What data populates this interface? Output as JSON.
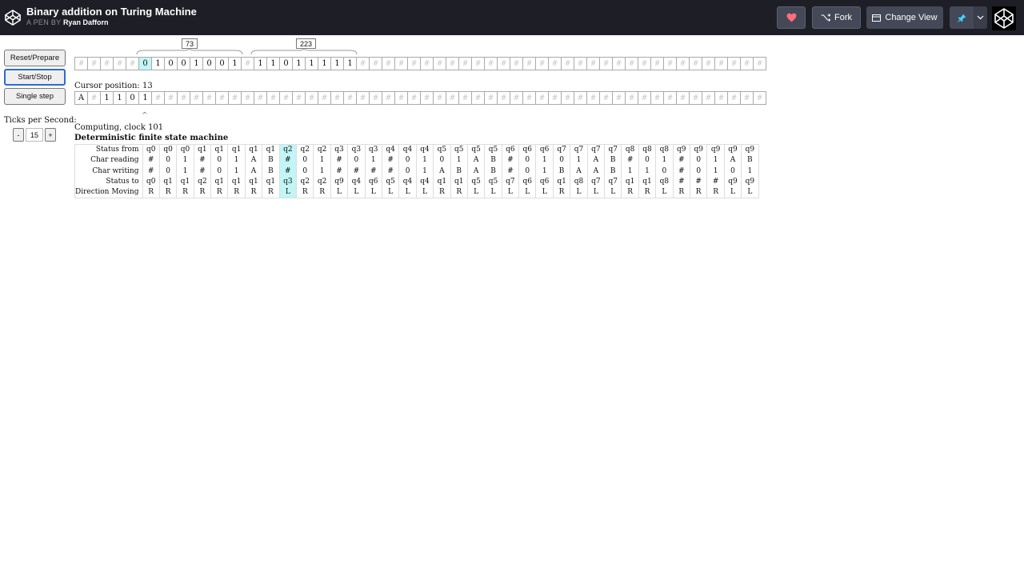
{
  "header": {
    "title": "Binary addition on Turing Machine",
    "byline_prefix": "A PEN BY",
    "author": "Ryan Dafforn",
    "fork_label": "Fork",
    "change_view_label": "Change View"
  },
  "colors": {
    "topbar": "#1e1f26",
    "header_button": "#444857",
    "heart": "#ff6e7a",
    "pin": "#47cff5",
    "highlight": "#c2f5f5"
  },
  "controls": {
    "reset_label": "Reset/Prepare",
    "start_label": "Start/Stop",
    "step_label": "Single step",
    "ticks_label": "Ticks per Second:",
    "minus_label": "-",
    "ticks_value": "15",
    "plus_label": "+"
  },
  "tape": {
    "marker_a": "73",
    "marker_b": "223",
    "highlight_index": 5,
    "cells": [
      "#",
      "#",
      "#",
      "#",
      "#",
      "0",
      "1",
      "0",
      "0",
      "1",
      "0",
      "0",
      "1",
      "#",
      "1",
      "1",
      "0",
      "1",
      "1",
      "1",
      "1",
      "1",
      "#",
      "#",
      "#",
      "#",
      "#",
      "#",
      "#",
      "#",
      "#",
      "#",
      "#",
      "#",
      "#",
      "#",
      "#",
      "#",
      "#",
      "#",
      "#",
      "#",
      "#",
      "#",
      "#",
      "#",
      "#",
      "#",
      "#",
      "#",
      "#",
      "#",
      "#",
      "#"
    ]
  },
  "cursor_tape": {
    "position_text": "Cursor position: 13",
    "caret": "^",
    "cells": [
      "A",
      "#",
      "1",
      "1",
      "0",
      "1",
      "#",
      "#",
      "#",
      "#",
      "#",
      "#",
      "#",
      "#",
      "#",
      "#",
      "#",
      "#",
      "#",
      "#",
      "#",
      "#",
      "#",
      "#",
      "#",
      "#",
      "#",
      "#",
      "#",
      "#",
      "#",
      "#",
      "#",
      "#",
      "#",
      "#",
      "#",
      "#",
      "#",
      "#",
      "#",
      "#",
      "#",
      "#",
      "#",
      "#",
      "#",
      "#",
      "#",
      "#",
      "#",
      "#",
      "#",
      "#"
    ]
  },
  "status": {
    "computing": "Computing, clock 101",
    "fsm_title": "Deterministic finite state machine"
  },
  "fsm": {
    "highlight_col": 8,
    "rows": [
      {
        "label": "Status from",
        "cells": [
          "q0",
          "q0",
          "q0",
          "q1",
          "q1",
          "q1",
          "q1",
          "q1",
          "q2",
          "q2",
          "q2",
          "q3",
          "q3",
          "q3",
          "q4",
          "q4",
          "q4",
          "q5",
          "q5",
          "q5",
          "q5",
          "q6",
          "q6",
          "q6",
          "q7",
          "q7",
          "q7",
          "q7",
          "q8",
          "q8",
          "q8",
          "q9",
          "q9",
          "q9",
          "q9",
          "q9"
        ]
      },
      {
        "label": "Char reading",
        "cells": [
          "#",
          "0",
          "1",
          "#",
          "0",
          "1",
          "A",
          "B",
          "#",
          "0",
          "1",
          "#",
          "0",
          "1",
          "#",
          "0",
          "1",
          "0",
          "1",
          "A",
          "B",
          "#",
          "0",
          "1",
          "0",
          "1",
          "A",
          "B",
          "#",
          "0",
          "1",
          "#",
          "0",
          "1",
          "A",
          "B"
        ]
      },
      {
        "label": "Char writing",
        "cells": [
          "#",
          "0",
          "1",
          "#",
          "0",
          "1",
          "A",
          "B",
          "#",
          "0",
          "1",
          "#",
          "#",
          "#",
          "#",
          "0",
          "1",
          "A",
          "B",
          "A",
          "B",
          "#",
          "0",
          "1",
          "B",
          "A",
          "A",
          "B",
          "1",
          "1",
          "0",
          "#",
          "0",
          "1",
          "0",
          "1"
        ]
      },
      {
        "label": "Status to",
        "cells": [
          "q0",
          "q1",
          "q1",
          "q2",
          "q1",
          "q1",
          "q1",
          "q1",
          "q3",
          "q2",
          "q2",
          "q9",
          "q4",
          "q6",
          "q5",
          "q4",
          "q4",
          "q1",
          "q1",
          "q5",
          "q5",
          "q7",
          "q6",
          "q6",
          "q1",
          "q8",
          "q7",
          "q7",
          "q1",
          "q1",
          "q8",
          "#",
          "#",
          "#",
          "q9",
          "q9"
        ]
      },
      {
        "label": "Direction Moving",
        "cells": [
          "R",
          "R",
          "R",
          "R",
          "R",
          "R",
          "R",
          "R",
          "L",
          "R",
          "R",
          "L",
          "L",
          "L",
          "L",
          "L",
          "L",
          "R",
          "R",
          "L",
          "L",
          "L",
          "L",
          "L",
          "R",
          "L",
          "L",
          "L",
          "R",
          "R",
          "L",
          "R",
          "R",
          "R",
          "L",
          "L"
        ]
      }
    ]
  }
}
